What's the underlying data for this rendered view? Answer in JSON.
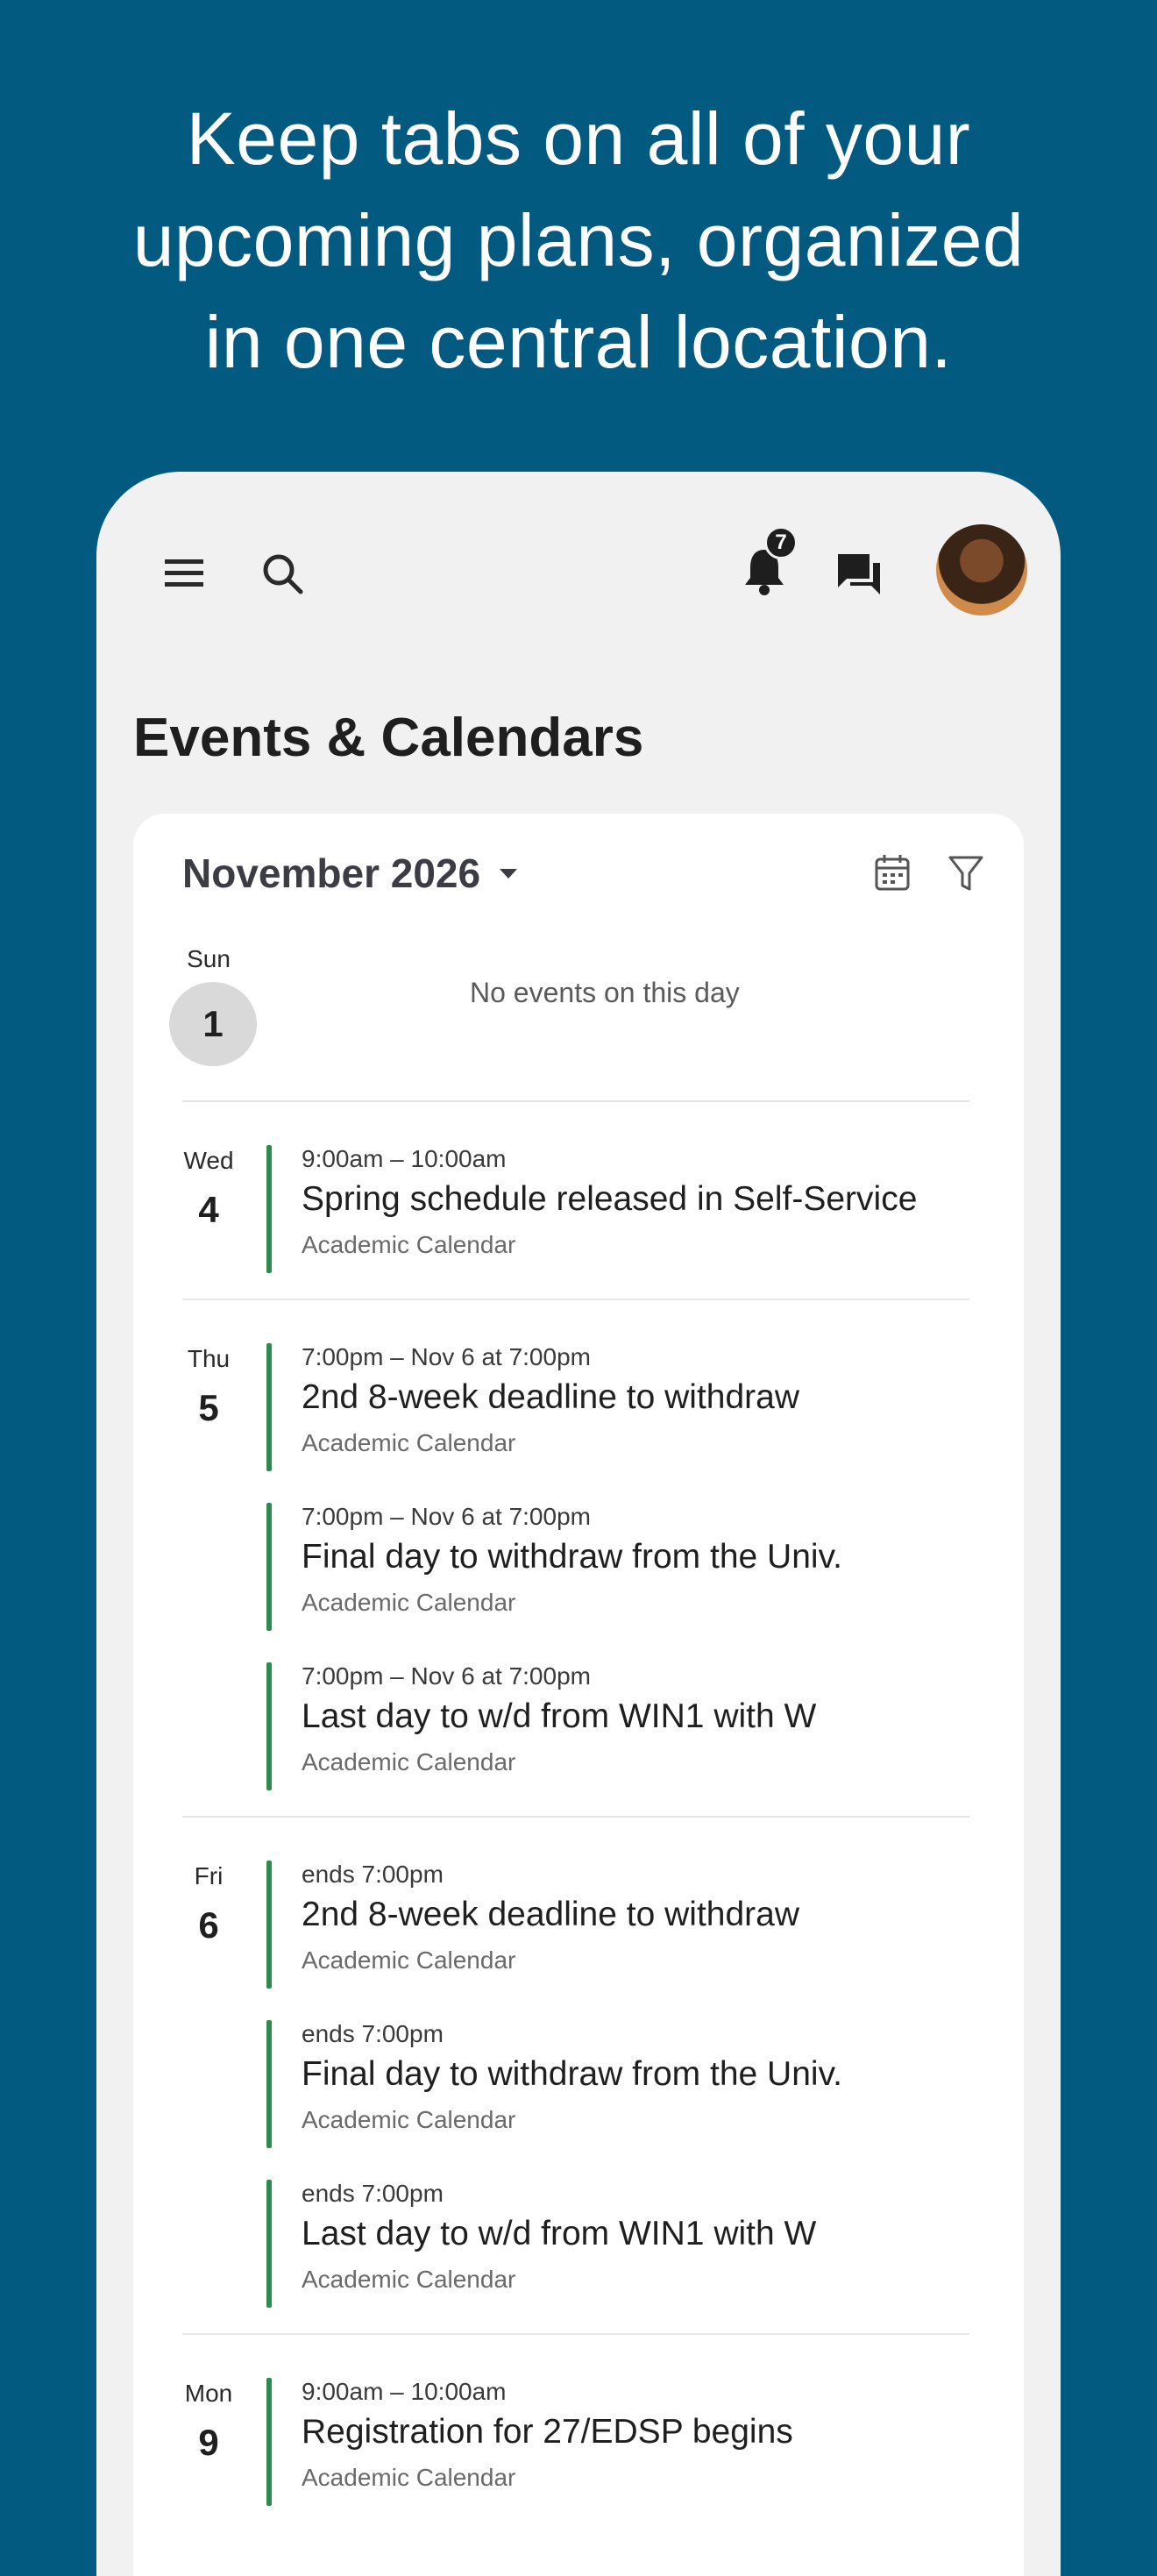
{
  "headline": {
    "line1": "Keep tabs on all of your",
    "line2": "upcoming plans, organized",
    "line3": "in one central location."
  },
  "topbar": {
    "notification_count": "7",
    "icons": [
      "menu-icon",
      "search-icon",
      "bell-icon",
      "chat-icon",
      "avatar"
    ]
  },
  "page_title": "Events & Calendars",
  "month": {
    "label": "November 2026"
  },
  "days": [
    {
      "dow": "Sun",
      "num": "1",
      "empty_text": "No events on this day"
    },
    {
      "dow": "Wed",
      "num": "4",
      "events": [
        {
          "time": "9:00am – 10:00am",
          "title": "Spring schedule released in Self-Service",
          "calendar": "Academic Calendar"
        }
      ]
    },
    {
      "dow": "Thu",
      "num": "5",
      "events": [
        {
          "time": "7:00pm – Nov 6 at 7:00pm",
          "title": "2nd 8-week deadline to withdraw",
          "calendar": "Academic Calendar"
        },
        {
          "time": "7:00pm – Nov 6 at 7:00pm",
          "title": "Final day to withdraw from the Univ.",
          "calendar": "Academic Calendar"
        },
        {
          "time": "7:00pm – Nov 6 at 7:00pm",
          "title": "Last day to w/d from WIN1 with W",
          "calendar": "Academic Calendar"
        }
      ]
    },
    {
      "dow": "Fri",
      "num": "6",
      "events": [
        {
          "time": "ends 7:00pm",
          "title": "2nd 8-week deadline to withdraw",
          "calendar": "Academic Calendar"
        },
        {
          "time": "ends 7:00pm",
          "title": "Final day to withdraw from the Univ.",
          "calendar": "Academic Calendar"
        },
        {
          "time": "ends 7:00pm",
          "title": "Last day to w/d from WIN1 with W",
          "calendar": "Academic Calendar"
        }
      ]
    },
    {
      "dow": "Mon",
      "num": "9",
      "events": [
        {
          "time": "9:00am – 10:00am",
          "title": "Registration for 27/EDSP begins",
          "calendar": "Academic Calendar"
        }
      ]
    }
  ],
  "colors": {
    "background": "#025a80",
    "event_bar": "#2f8a4e"
  }
}
